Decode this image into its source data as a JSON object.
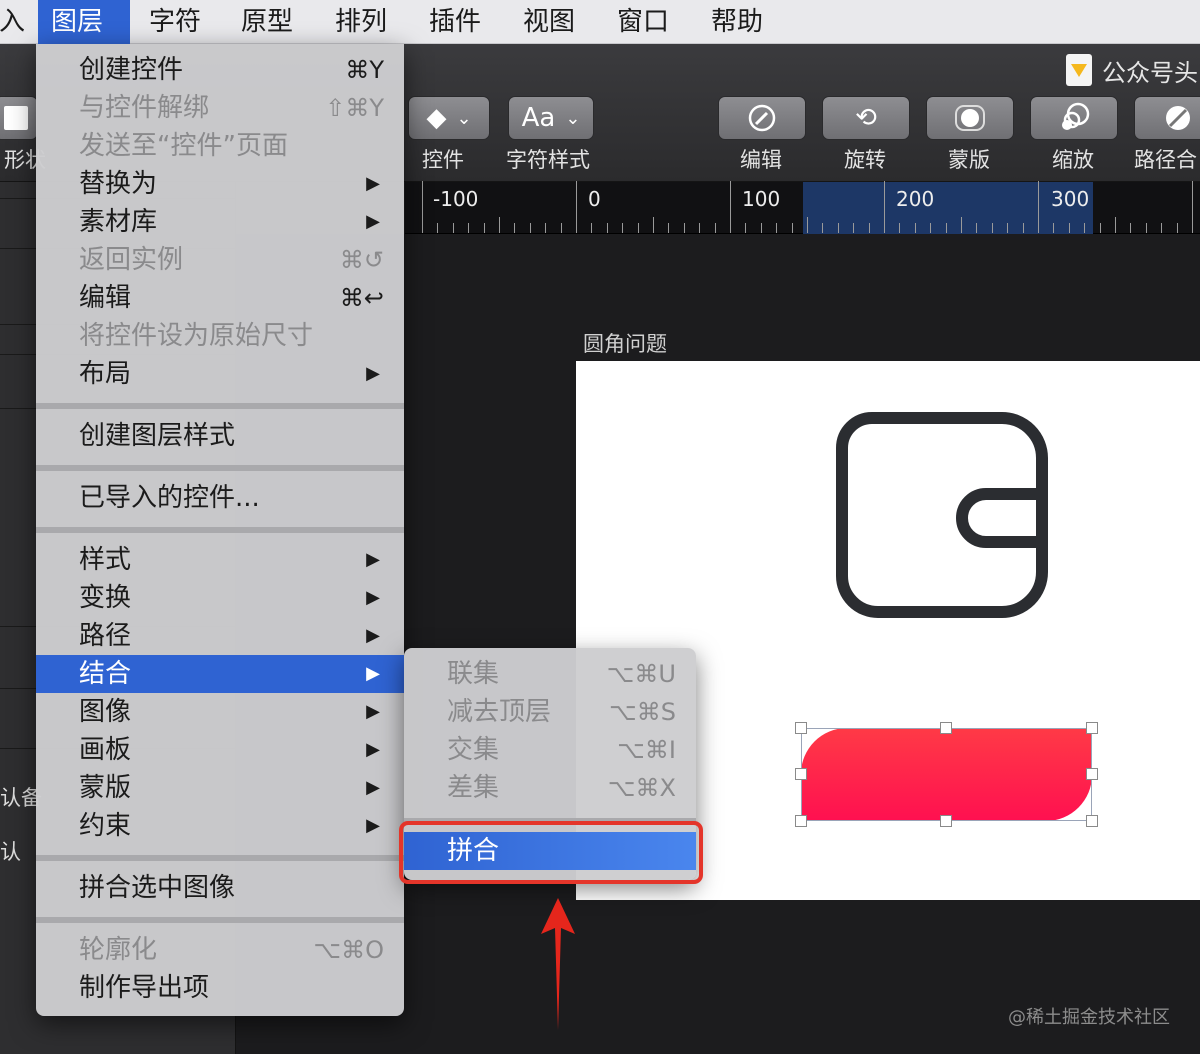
{
  "menubar": {
    "items": [
      {
        "label": "入"
      },
      {
        "label": "图层"
      },
      {
        "label": "字符"
      },
      {
        "label": "原型"
      },
      {
        "label": "排列"
      },
      {
        "label": "插件"
      },
      {
        "label": "视图"
      },
      {
        "label": "窗口"
      },
      {
        "label": "帮助"
      }
    ]
  },
  "toolbar": {
    "doc_title": "公众号头",
    "shape_label": "形状",
    "symbol_label": "控件",
    "text_style_glyph": "Aa",
    "text_style_label": "字符样式",
    "edit_label": "编辑",
    "rotate_label": "旋转",
    "mask_label": "蒙版",
    "scale_label": "缩放",
    "path_label": "路径合"
  },
  "left_panel": {
    "text1": "认备",
    "text2": "认"
  },
  "ruler": {
    "labels": [
      "-100",
      "0",
      "100",
      "200",
      "300"
    ]
  },
  "canvas": {
    "artboard_title": "圆角问题",
    "watermark": "@稀土掘金技术社区"
  },
  "layer_menu": {
    "items": [
      {
        "label": "创建控件",
        "shortcut": "⌘Y"
      },
      {
        "label": "与控件解绑",
        "shortcut": "⇧⌘Y"
      },
      {
        "label": "发送至“控件”页面"
      },
      {
        "label": "替换为"
      },
      {
        "label": "素材库"
      },
      {
        "label": "返回实例",
        "shortcut": "⌘↺"
      },
      {
        "label": "编辑",
        "shortcut": "⌘↩"
      },
      {
        "label": "将控件设为原始尺寸"
      },
      {
        "label": "布局"
      },
      {
        "label": "创建图层样式"
      },
      {
        "label": "已导入的控件..."
      },
      {
        "label": "样式"
      },
      {
        "label": "变换"
      },
      {
        "label": "路径"
      },
      {
        "label": "结合"
      },
      {
        "label": "图像"
      },
      {
        "label": "画板"
      },
      {
        "label": "蒙版"
      },
      {
        "label": "约束"
      },
      {
        "label": "拼合选中图像"
      },
      {
        "label": "轮廓化",
        "shortcut": "⌥⌘O"
      },
      {
        "label": "制作导出项"
      }
    ],
    "submenu_arrow": "▶"
  },
  "combine_submenu": {
    "items": [
      {
        "label": "联集",
        "shortcut": "⌥⌘U"
      },
      {
        "label": "减去顶层",
        "shortcut": "⌥⌘S"
      },
      {
        "label": "交集",
        "shortcut": "⌥⌘I"
      },
      {
        "label": "差集",
        "shortcut": "⌥⌘X"
      },
      {
        "label": "拼合"
      }
    ]
  },
  "colors": {
    "menu_highlight": "#2f63d2",
    "callout": "#e4352a",
    "shape_gradient_top": "#ff3a46",
    "shape_gradient_bottom": "#ff1050"
  }
}
